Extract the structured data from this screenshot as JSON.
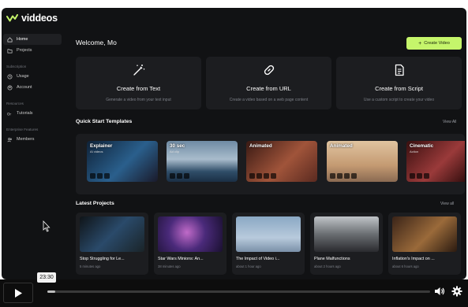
{
  "app": {
    "name": "viddeos"
  },
  "sidebar": {
    "items": [
      {
        "label": "Home",
        "icon": "home-icon",
        "active": true
      },
      {
        "label": "Projects",
        "icon": "folder-icon"
      }
    ],
    "sections": [
      {
        "title": "Subscription",
        "items": [
          {
            "label": "Usage",
            "icon": "clock-icon"
          },
          {
            "label": "Account",
            "icon": "user-icon"
          }
        ]
      },
      {
        "title": "Resources",
        "items": [
          {
            "label": "Tutorials",
            "icon": "tutorials-icon"
          }
        ]
      },
      {
        "title": "Enterprise Features",
        "items": [
          {
            "label": "Members",
            "icon": "members-icon"
          }
        ]
      }
    ]
  },
  "header": {
    "welcome": "Welcome, Mo",
    "create_button": "Create Video"
  },
  "create_cards": [
    {
      "title": "Create from Text",
      "desc": "Generate a video from your text input",
      "icon": "magic-wand-icon"
    },
    {
      "title": "Create from URL",
      "desc": "Create a video based on a web page content",
      "icon": "link-icon"
    },
    {
      "title": "Create from Script",
      "desc": "Use a custom script to create your video",
      "icon": "script-icon"
    }
  ],
  "templates": {
    "title": "Quick Start Templates",
    "view_all": "View All",
    "items": [
      {
        "name": "Explainer",
        "sub": "AI videos",
        "bg": "#1a3a5c"
      },
      {
        "name": "30 sec",
        "sub": "Ad clip",
        "bg": "#3d5a78"
      },
      {
        "name": "Animated",
        "sub": "",
        "bg": "#7a3a2a"
      },
      {
        "name": "Animated",
        "sub": "",
        "bg": "#c9a07a"
      },
      {
        "name": "Cinematic",
        "sub": "Action",
        "bg": "#6a2a2a"
      }
    ]
  },
  "projects": {
    "title": "Latest Projects",
    "view_all": "View all",
    "items": [
      {
        "title": "Stop Struggling for Le...",
        "time": "5 minutes ago"
      },
      {
        "title": "Star Wars Minions: An...",
        "time": "38 minutes ago"
      },
      {
        "title": "The Impact of Video i...",
        "time": "about 1 hour ago"
      },
      {
        "title": "Plane Malfunctions",
        "time": "about 2 hours ago"
      },
      {
        "title": "Inflation's Impact on ...",
        "time": "about 6 hours ago"
      }
    ]
  },
  "player": {
    "time": "23:30",
    "progress": 0.02
  },
  "colors": {
    "accent": "#c5f56b",
    "background": "#111214",
    "card": "#1c1d20"
  }
}
